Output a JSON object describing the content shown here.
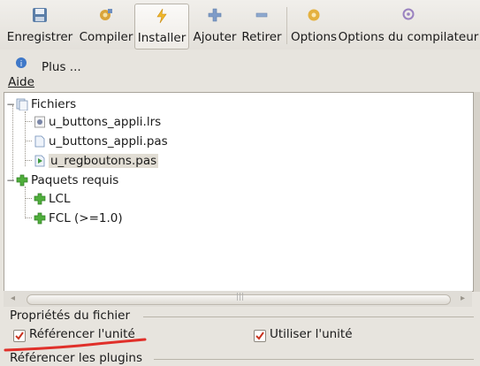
{
  "toolbar": {
    "buttons": [
      {
        "label": "Enregistrer",
        "icon": "save-icon"
      },
      {
        "label": "Compiler",
        "icon": "compile-icon"
      },
      {
        "label": "Installer",
        "icon": "install-icon",
        "active": true
      },
      {
        "label": "Ajouter",
        "icon": "add-icon"
      },
      {
        "label": "Retirer",
        "icon": "remove-icon"
      },
      {
        "label": "Options",
        "icon": "options-icon"
      },
      {
        "label": "Options du compilateur",
        "icon": "compiler-options-icon"
      }
    ],
    "help": {
      "label": "Aide",
      "icon": "help-icon"
    },
    "more": {
      "label": "Plus ..."
    }
  },
  "tree": {
    "files_node": {
      "label": "Fichiers",
      "icon": "files-folder-icon"
    },
    "files": [
      {
        "label": "u_buttons_appli.lrs",
        "icon": "resource-file-icon"
      },
      {
        "label": "u_buttons_appli.pas",
        "icon": "pascal-file-icon"
      },
      {
        "label": "u_regboutons.pas",
        "icon": "register-unit-icon",
        "selected": true
      }
    ],
    "packages_node": {
      "label": "Paquets requis",
      "icon": "package-icon"
    },
    "packages": [
      {
        "label": "LCL",
        "icon": "package-icon"
      },
      {
        "label": "FCL (>=1.0)",
        "icon": "package-icon"
      }
    ]
  },
  "file_properties": {
    "title": "Propriétés du fichier",
    "reference_unit": {
      "label": "Référencer l'unité",
      "checked": true
    },
    "use_unit": {
      "label": "Utiliser l'unité",
      "checked": true
    }
  },
  "plugins": {
    "title": "Référencer les plugins"
  },
  "colors": {
    "check": "#c8321e",
    "annotation": "#e0302a",
    "selection": "#e1ddd4"
  }
}
